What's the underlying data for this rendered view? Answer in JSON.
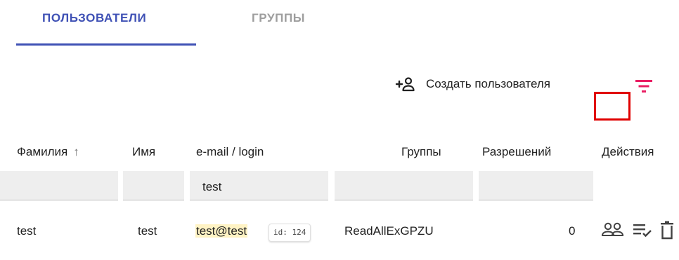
{
  "tabs": [
    {
      "label": "ПОЛЬЗОВАТЕЛИ",
      "active": true
    },
    {
      "label": "ГРУППЫ",
      "active": false
    }
  ],
  "toolbar": {
    "create_label": "Создать пользователя",
    "create_icon": "add-person-icon",
    "filter_icon": "filter-icon"
  },
  "table": {
    "columns": [
      {
        "label": "Фамилия",
        "sort": "asc"
      },
      {
        "label": "Имя"
      },
      {
        "label": "e-mail / login"
      },
      {
        "label": "Группы"
      },
      {
        "label": "Разрешений"
      },
      {
        "label": "Действия"
      }
    ],
    "filters": {
      "email": "test"
    },
    "rows": [
      {
        "lastname": "test",
        "firstname": "test",
        "email": "test@test",
        "id_badge": "id: 124",
        "groups": "ReadAllExGPZU",
        "permissions": "0",
        "actions": [
          "groups-icon",
          "playlist-check-icon",
          "trash-icon"
        ]
      }
    ]
  },
  "colors": {
    "accent": "#3f51b5",
    "filter": "#e91e63",
    "highlight": "#e00000"
  }
}
